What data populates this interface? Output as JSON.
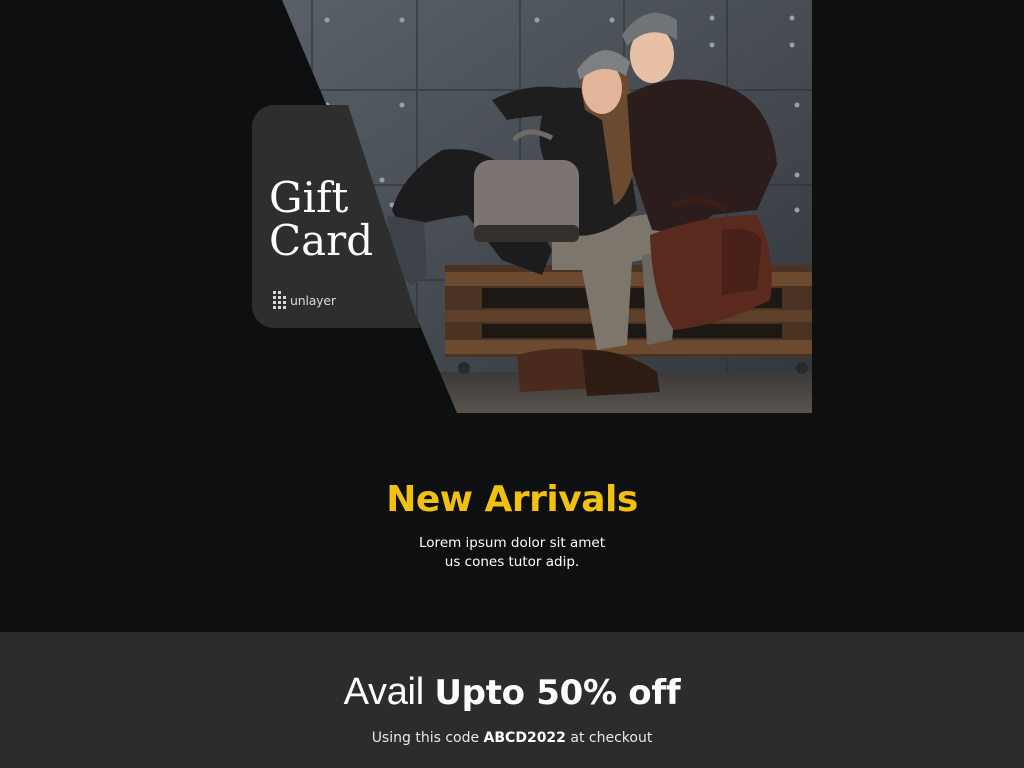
{
  "hero": {
    "gift_card_line1": "Gift",
    "gift_card_line2": "Card",
    "brand_name": "unlayer",
    "brand_logo_icon": "unlayer-logo-icon"
  },
  "arrivals": {
    "title": "New Arrivals",
    "description_line1": "Lorem ipsum dolor sit amet",
    "description_line2": "us cones tutor adip."
  },
  "offer": {
    "headline_prefix": "Avail",
    "headline_highlight": "Upto 50% off",
    "code_prefix": "Using this code",
    "code": "ABCD2022",
    "code_suffix": "at checkout"
  },
  "colors": {
    "background": "#0d0f10",
    "card": "#2e2e2e",
    "offer_band": "#2c2c2c",
    "accent": "#f2c10f",
    "text": "#ffffff"
  }
}
